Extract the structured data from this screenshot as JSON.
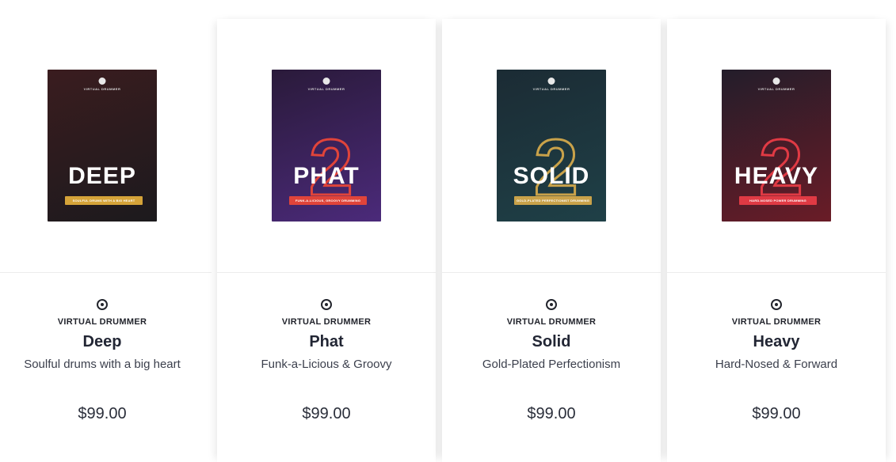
{
  "products": [
    {
      "cover": {
        "brand": "VIRTUAL DRUMMER",
        "title": "DEEP",
        "tagline": "SOULFUL DRUMS WITH A BIG HEART",
        "bg_top": "#3a1c1f",
        "bg_bottom": "#1c1a1d",
        "tag_color": "#d5a339",
        "accent": "#7a2a2a"
      },
      "brand": "VIRTUAL DRUMMER",
      "name": "Deep",
      "description": "Soulful drums with a big heart",
      "price": "$99.00"
    },
    {
      "cover": {
        "brand": "VIRTUAL DRUMMER",
        "title": "PHAT",
        "tagline": "FUNK-A-LICIOUS, GROOVY DRUMMING",
        "bg_top": "#2a1a3a",
        "bg_bottom": "#4b2a7a",
        "tag_color": "#e0443a",
        "accent": "#e0443a"
      },
      "brand": "VIRTUAL DRUMMER",
      "name": "Phat",
      "description": "Funk-a-Licious & Groovy",
      "price": "$99.00"
    },
    {
      "cover": {
        "brand": "VIRTUAL DRUMMER",
        "title": "SOLID",
        "tagline": "GOLD-PLATED PERFECTIONIST DRUMMING",
        "bg_top": "#1b2b34",
        "bg_bottom": "#1f4047",
        "tag_color": "#c9a24a",
        "accent": "#c9a24a"
      },
      "brand": "VIRTUAL DRUMMER",
      "name": "Solid",
      "description": "Gold-Plated Perfectionism",
      "price": "$99.00"
    },
    {
      "cover": {
        "brand": "VIRTUAL DRUMMER",
        "title": "HEAVY",
        "tagline": "HARD-NOSED POWER DRUMMING",
        "bg_top": "#231d2a",
        "bg_bottom": "#6a1c27",
        "tag_color": "#e03a44",
        "accent": "#e03a44"
      },
      "brand": "VIRTUAL DRUMMER",
      "name": "Heavy",
      "description": "Hard-Nosed & Forward",
      "price": "$99.00"
    }
  ]
}
